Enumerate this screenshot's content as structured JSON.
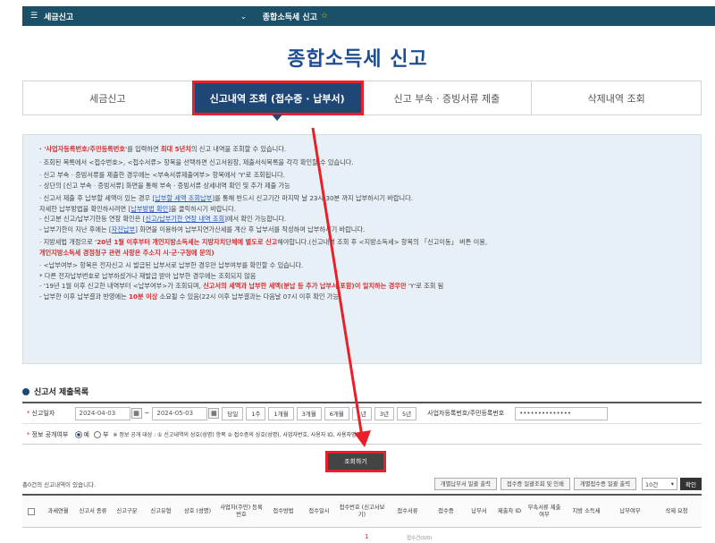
{
  "topbar": {
    "menu_icon": "menu-icon",
    "crumb1": "세금신고",
    "chevron_icon": "chevron-down-icon",
    "crumb2": "종합소득세 신고",
    "star_icon": "star-icon"
  },
  "page_title": "종합소득세 신고",
  "tabs": [
    {
      "label": "세금신고"
    },
    {
      "label": "신고내역 조회 (접수증 · 납부서)"
    },
    {
      "label": "신고 부속 · 증빙서류 제출"
    },
    {
      "label": "삭제내역 조회"
    }
  ],
  "info": {
    "l1a": "· '사업자등록번호/주민등록번호'",
    "l1b": "를 입력하면",
    "l1c": "최대 5년치",
    "l1d": "의 신고 내역을 조회할 수 있습니다.",
    "l2": "· 조회된 목록에서 <접수번호>, <접수서류> 항목을 선택하면 신고서원장, 제출서식목록을 각각 확인할 수 있습니다.",
    "l3": "· 신고 부속 · 증빙서류를 제출한 경우에는 <부속서류제출여부> 항목에서 'Y'로 조회됩니다.",
    "l4": "  - 상단의 [신고 부속 · 증빙서류] 화면을 통해 부속 · 증빙서류 상세내역 확인 및 추가 제출 가능",
    "l5a": "· 신고서 제출 후 납부할 세액이 있는 경우 [",
    "l5b": "납부할 세액 조회납부",
    "l5c": "]를 통해 반드시 신고기간 마지막 날 23시 30분 까지 납부하시기 바랍니다.",
    "l6a": "  자세한 납부방법을 확인하시려면 [",
    "l6b": "납부방법 확인",
    "l6c": "]을 클릭하시기 바랍니다.",
    "l7a": "  - 신고분 신고/납부기한등 연장 확인은 [",
    "l7b": "신고/납부기한 연장 내역 조회",
    "l7c": "]에서 확인 가능합니다.",
    "l8a": "  - 납부기한이 지난 후에는 [",
    "l8b": "자진납부",
    "l8c": "] 화면을 이용하여 납부지연가산세를 계산 후 납부서를 작성하여 납부하시기 바랍니다.",
    "l9a": "· 지방세법 개정으로 ",
    "l9b": "'20년 1월 이후부터 개인지방소득세는 지방자치단체에 별도로 신고",
    "l9c": "해야합니다.(신고내역 조회 후 <지방소득세> 항목의 「신고이동」 버튼 이용,",
    "l10": "  개인지방소득세 경정청구 관련 사항은 주소지 시·군·구청에 문의)",
    "l11": "· <납부여부> 항목은 전자신고 시 발급된 납부서로 납부한 경우만 납부여부를 확인할 수 있습니다.",
    "l12": "  * 다른 전자납부번호로 납부하셨거나 재발급 받아 납부한 경우에는 조회되지 않음",
    "l13a": "  - '19년 1월 이후 신고한 내역부터 <납부여부>가 조회되며, ",
    "l13b": "신고서의 세액과 납부한 세액(분납 등 추가 납부서 포함)이 일치하는 경우만",
    "l13c": " 'Y'로 조회 됨",
    "l14a": "  - 납부한 이후 납부결과 반영에는 ",
    "l14b": "10분 이상",
    "l14c": " 소요될 수 있음(22시 이후 납부결과는 다음날 07시 이후 확인 가능)"
  },
  "search": {
    "section_title": "신고서 제출목록",
    "date_label": "신고일자",
    "date_from": "2024-04-03",
    "date_to": "2024-05-03",
    "tilde": "~",
    "periods": [
      "당일",
      "1주",
      "1개월",
      "3개월",
      "6개월",
      "1년",
      "3년",
      "5년"
    ],
    "id_label": "사업자등록번호/주민등록번호",
    "id_value": "••••••••••••••",
    "public_label": "정보 공개여부",
    "yes": "예",
    "no": "부",
    "public_note": "※ 정보 공개 대상 : ① 신고내역의 상호(성명) 항목 ② 접수증의 상호(성명), 사업자번호, 사용자 ID, 사용자명 항목",
    "search_button": "조회하기"
  },
  "toolbar": {
    "count_text": "총0건의 신고내역이 있습니다.",
    "btn1": "개별납부서 일괄 출력",
    "btn2": "접수증 일괄조회 및 인쇄",
    "btn3": "개별접수증 일괄 출력",
    "page_size": "10건",
    "ok": "확인"
  },
  "table": {
    "headers": [
      "과세연월",
      "신고서 종류",
      "신고구분",
      "신고유형",
      "상호 (성명)",
      "사업자(주민) 등록번호",
      "접수방법",
      "접수일시",
      "접수번호 (신고서보기)",
      "접수서류",
      "접수증",
      "납부서",
      "제출자 ID",
      "부속서류 제출여부",
      "지방 소득세",
      "납부여부",
      "삭제 요청"
    ],
    "cell1": "1",
    "cell2": "접수건(0/0)"
  }
}
